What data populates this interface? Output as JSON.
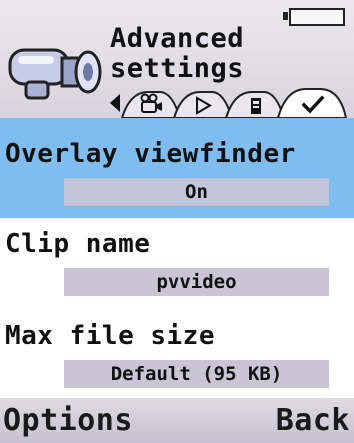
{
  "status": {
    "battery_icon": "battery-icon"
  },
  "header": {
    "app_icon": "video-recorder-icon",
    "title_line1": "Advanced",
    "title_line2": "settings"
  },
  "tabs": [
    {
      "icon": "video-camera-icon",
      "active": false
    },
    {
      "icon": "play-icon",
      "active": false
    },
    {
      "icon": "storage-icon",
      "active": false
    },
    {
      "icon": "checkmark-icon",
      "active": true
    }
  ],
  "settings": [
    {
      "label": "Overlay viewfinder",
      "value": "On",
      "selected": true
    },
    {
      "label": "Clip name",
      "value": "pvvideo",
      "selected": false
    },
    {
      "label": "Max file size",
      "value": "Default (95 KB)",
      "selected": false
    }
  ],
  "softkeys": {
    "left": "Options",
    "right": "Back"
  },
  "colors": {
    "selection_highlight": "#7fbcf0",
    "value_field": "#c9c5d4",
    "header_background": "#dfdce6"
  }
}
